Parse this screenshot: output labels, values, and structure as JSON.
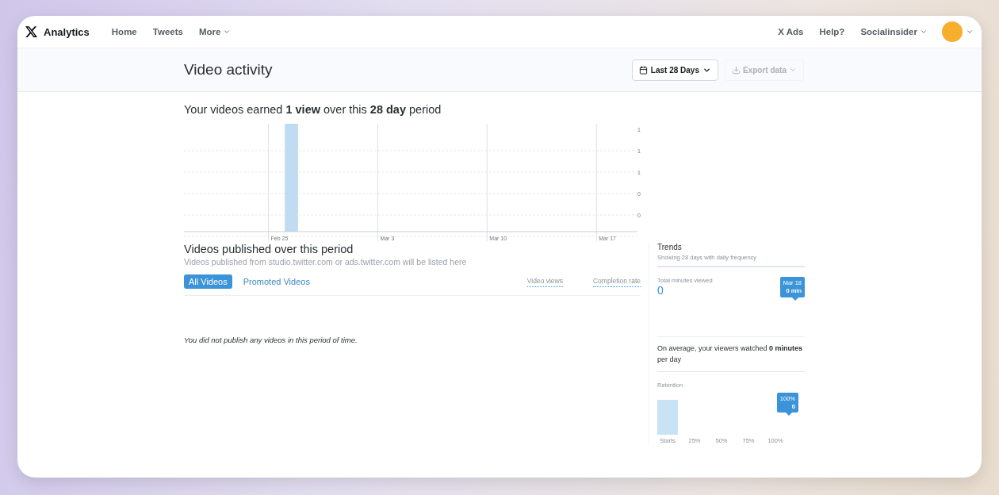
{
  "nav": {
    "brand": "Analytics",
    "links": [
      {
        "label": "Home",
        "caret": false
      },
      {
        "label": "Tweets",
        "caret": false
      },
      {
        "label": "More",
        "caret": true
      }
    ],
    "right_links": [
      {
        "label": "X Ads",
        "caret": false
      },
      {
        "label": "Help?",
        "caret": false
      },
      {
        "label": "Socialinsider",
        "caret": true
      }
    ]
  },
  "header": {
    "title": "Video activity",
    "range_button": "Last 28 Days",
    "export_button": "Export data"
  },
  "summary": "Your videos earned **1 view** over this **28 day** period",
  "views_chart": {
    "x_labels": [
      "Feb 25",
      "Mar 3",
      "Mar 10",
      "Mar 17"
    ],
    "y_labels": [
      "1",
      "1",
      "1",
      "0",
      "0"
    ]
  },
  "videos": {
    "title": "Videos published over this period",
    "subtitle": "Videos published from studio.twitter.com or ads.twitter.com will be listed here",
    "tabs": [
      {
        "label": "All Videos",
        "selected": true
      },
      {
        "label": "Promoted Videos",
        "selected": false
      }
    ],
    "columns": [
      "Video views",
      "Completion rate"
    ],
    "empty_message": "You did not publish any videos in this period of time."
  },
  "trends": {
    "title": "Trends",
    "subtitle": "Showing 28 days with daily frequency",
    "total_label": "Total minutes viewed",
    "total_value": "0",
    "total_tooltip": {
      "title": "Mar 18",
      "value": "0 min"
    },
    "average": "On average, your viewers watched **0 minutes** per day",
    "retention_label": "Retention",
    "retention_tooltip": {
      "title": "100%",
      "value": "0"
    },
    "retention_labels": [
      "Starts",
      "25%",
      "50%",
      "75%",
      "100%"
    ]
  }
}
